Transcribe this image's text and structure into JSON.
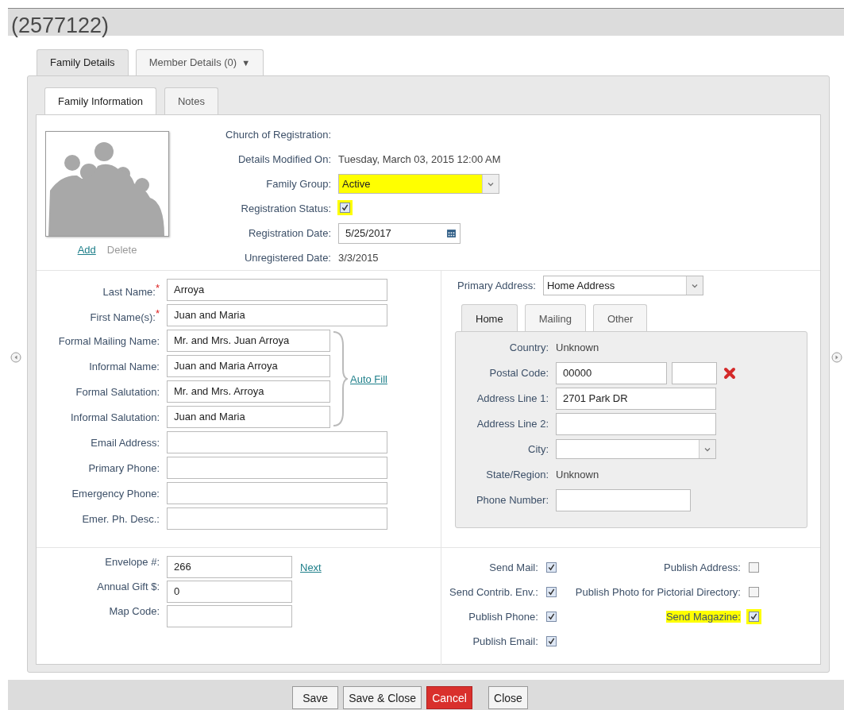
{
  "title": "(2577122)",
  "outer_tabs": [
    {
      "label": "Family Details",
      "selected": true
    },
    {
      "label": "Member Details (0)",
      "selected": false,
      "menu": "▼"
    }
  ],
  "inner_tabs": [
    {
      "label": "Family Information",
      "selected": true
    },
    {
      "label": "Notes",
      "selected": false
    }
  ],
  "photo_actions": [
    {
      "label": "Add",
      "disabled": false
    },
    {
      "label": "Delete",
      "disabled": true
    }
  ],
  "registration": [
    {
      "kind": "text",
      "label": "Church of Registration:"
    },
    {
      "kind": "text",
      "label": "Details Modified On:",
      "value": "Tuesday, March 03, 2015 12:00 AM"
    },
    {
      "kind": "select",
      "label": "Family Group:",
      "value": "Active",
      "highlighted": true
    },
    {
      "kind": "checkbox",
      "label": "Registration Status:",
      "checked": true,
      "highlighted": true
    },
    {
      "kind": "date",
      "label": "Registration Date:",
      "value": "5/25/2017"
    },
    {
      "kind": "text",
      "label": "Unregistered Date:",
      "value": "3/3/2015"
    }
  ],
  "names": [
    {
      "label": "Last Name:",
      "required": "*",
      "value": "Arroya"
    },
    {
      "label": "First Name(s):",
      "required": "*",
      "value": "Juan and Maria"
    }
  ],
  "salutations": [
    {
      "label": "Formal Mailing Name:",
      "value": "Mr. and Mrs. Juan Arroya"
    },
    {
      "label": "Informal Name:",
      "value": "Juan and Maria Arroya"
    },
    {
      "label": "Formal Salutation:",
      "value": "Mr. and Mrs. Arroya"
    },
    {
      "label": "Informal Salutation:",
      "value": "Juan and Maria"
    }
  ],
  "auto_fill": "Auto Fill",
  "contact": [
    {
      "label": "Email Address:"
    },
    {
      "label": "Primary Phone:"
    },
    {
      "label": "Emergency Phone:"
    },
    {
      "label": "Emer. Ph. Desc.:"
    }
  ],
  "primary_address": {
    "label": "Primary Address:",
    "value": "Home Address"
  },
  "address_tabs": [
    {
      "label": "Home",
      "selected": true
    },
    {
      "label": "Mailing",
      "selected": false
    },
    {
      "label": "Other",
      "selected": false
    }
  ],
  "address_fields": [
    {
      "kind": "text",
      "label": "Country:",
      "value": "Unknown"
    },
    {
      "kind": "postal",
      "label": "Postal Code:",
      "value": "00000"
    },
    {
      "kind": "input",
      "label": "Address Line 1:",
      "value": "2701 Park DR"
    },
    {
      "kind": "input",
      "label": "Address Line 2:"
    },
    {
      "kind": "select",
      "label": "City:"
    },
    {
      "kind": "text",
      "label": "State/Region:",
      "value": "Unknown"
    },
    {
      "kind": "short",
      "label": "Phone Number:"
    }
  ],
  "giving": [
    {
      "label": "Envelope #:",
      "value": "266",
      "link": "Next"
    },
    {
      "label": "Annual Gift $:",
      "value": "0"
    },
    {
      "label": "Map Code:"
    }
  ],
  "options_left": [
    {
      "label": "Send Mail:",
      "checked": true,
      "highlighted": false
    },
    {
      "label": "Send Contrib. Env.:",
      "checked": true,
      "highlighted": false
    },
    {
      "label": "Publish Phone:",
      "checked": true,
      "highlighted": false
    },
    {
      "label": "Publish Email:",
      "checked": true,
      "highlighted": false
    }
  ],
  "options_right": [
    {
      "label": "Publish Address:",
      "checked": false,
      "highlighted": false
    },
    {
      "label": "Publish Photo for Pictorial Directory:",
      "checked": false,
      "highlighted": false
    },
    {
      "label": "Send Magazine:",
      "checked": true,
      "highlighted": true
    }
  ],
  "buttons": [
    {
      "label": "Save",
      "kind": "default"
    },
    {
      "label": "Save & Close",
      "kind": "default"
    },
    {
      "label": "Cancel",
      "kind": "danger"
    },
    {
      "label": "Close",
      "kind": "default"
    }
  ]
}
